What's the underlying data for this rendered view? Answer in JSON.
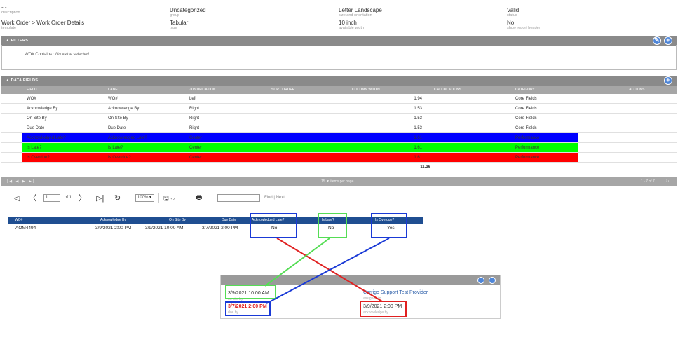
{
  "info": {
    "description_value": "- -",
    "description_label": "description",
    "template_value": "Work Order > Work Order Details",
    "template_label": "template",
    "group_value": "Uncategorized",
    "group_label": "group",
    "type_value": "Tabular",
    "type_label": "type",
    "size_value": "Letter Landscape",
    "size_label": "size and orientation",
    "width_value": "10 inch",
    "width_label": "available width",
    "status_value": "Valid",
    "status_label": "status",
    "header_value": "No",
    "header_label": "show report header"
  },
  "filters": {
    "title": "▲ FILTERS",
    "field": "WO#",
    "operator": "Contains",
    "value": "No value selected"
  },
  "data_fields": {
    "title": "▲ DATA FIELDS",
    "columns": [
      "FIELD",
      "LABEL",
      "JUSTIFICATION",
      "SORT ORDER",
      "COLUMN WIDTH",
      "CALCULATIONS",
      "CATEGORY",
      "ACTIONS"
    ],
    "rows": [
      {
        "field": "WO#",
        "label": "WO#",
        "justification": "Left",
        "width": "1.94",
        "category": "Core Fields"
      },
      {
        "field": "Acknowledge By",
        "label": "Acknowledge By",
        "justification": "Right",
        "width": "1.53",
        "category": "Core Fields"
      },
      {
        "field": "On Site By",
        "label": "On Site By",
        "justification": "Right",
        "width": "1.53",
        "category": "Core Fields"
      },
      {
        "field": "Due Date",
        "label": "Due Date",
        "justification": "Right",
        "width": "1.53",
        "category": "Core Fields"
      },
      {
        "field": "Acknowledged Late?",
        "label": "Acknowledged Late?",
        "justification": "Center",
        "width": "1.61",
        "category": "Performance"
      },
      {
        "field": "Is Late?",
        "label": "Is Late?",
        "justification": "Center",
        "width": "1.61",
        "category": "Performance"
      },
      {
        "field": "Is Overdue?",
        "label": "Is Overdue?",
        "justification": "Center",
        "width": "1.61",
        "category": "Performance"
      }
    ],
    "total": "11.36",
    "pager_size": "15 ▼  items per page",
    "pager_count": "1 - 7 of 7",
    "pager_nav": "|◀  ◀  ▶  ▶|",
    "highlight_colors": [
      "#0000ff",
      "#00ff00",
      "#ff0000"
    ]
  },
  "toolbar": {
    "first": "|◁",
    "prev": "〈",
    "page_value": "1",
    "page_of": "of 1",
    "next": "〉",
    "last": "▷|",
    "refresh": "↻",
    "zoom": "100% ▾",
    "save": "🖫 ⌵",
    "print": "🖶",
    "find_next": "Find | Next"
  },
  "report": {
    "headers": [
      "WO#",
      "Acknowledge By",
      "On Site By",
      "Due Date",
      "Acknowledged Late?",
      "Is Late?",
      "Is Overdue?"
    ],
    "row": [
      "AOM4494",
      "3/9/2021 2:00 PM",
      "3/9/2021 10:00 AM",
      "3/7/2021 2:00 PM",
      "No",
      "No",
      "Yes"
    ],
    "header_color": "#1f4e91"
  },
  "card": {
    "on_site_value": "3/9/2021 10:00 AM",
    "on_site_label": "on site by",
    "due_value": "3/7/2021 2:00 PM",
    "due_label": "due by",
    "provider_value": "Corrigo Support Test Provider",
    "provider_label": "assigned to",
    "ack_value": "3/9/2021 2:00 PM",
    "ack_label": "acknowledge by"
  },
  "annotation_colors": {
    "blue": "#1a3ad6",
    "green": "#55dd55",
    "red": "#e02020"
  }
}
